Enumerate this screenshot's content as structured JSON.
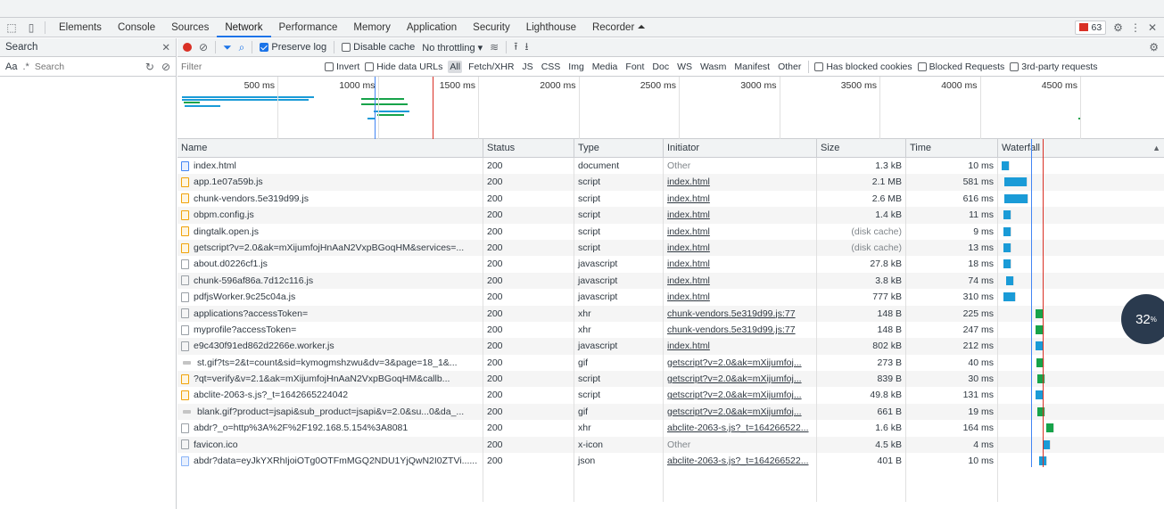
{
  "tabs": [
    "Elements",
    "Console",
    "Sources",
    "Network",
    "Performance",
    "Memory",
    "Application",
    "Security",
    "Lighthouse",
    "Recorder ⏶"
  ],
  "active_tab": "Network",
  "issues_count": "63",
  "left_pane": {
    "title": "Search",
    "aa_label": "Aa",
    "regex_label": ".*",
    "search_placeholder": "Search"
  },
  "toolbar": {
    "preserve_log": "Preserve log",
    "disable_cache": "Disable cache",
    "throttling": "No throttling"
  },
  "filter_bar": {
    "placeholder": "Filter",
    "invert": "Invert",
    "hide_data_urls": "Hide data URLs",
    "types": [
      "All",
      "Fetch/XHR",
      "JS",
      "CSS",
      "Img",
      "Media",
      "Font",
      "Doc",
      "WS",
      "Wasm",
      "Manifest",
      "Other"
    ],
    "has_blocked_cookies": "Has blocked cookies",
    "blocked_requests": "Blocked Requests",
    "third_party": "3rd-party requests"
  },
  "overview_ticks": [
    "500 ms",
    "1000 ms",
    "1500 ms",
    "2000 ms",
    "2500 ms",
    "3000 ms",
    "3500 ms",
    "4000 ms",
    "4500 ms"
  ],
  "columns": [
    "Name",
    "Status",
    "Type",
    "Initiator",
    "Size",
    "Time",
    "Waterfall"
  ],
  "colors": {
    "accent": "#1a73e8",
    "script_bar": "#1a9bd7",
    "xhr_bar": "#17a34a",
    "load_line": "#d93025",
    "dom_line": "#4285f4"
  },
  "rows": [
    {
      "name": "index.html",
      "icon": "doc",
      "status": "200",
      "type": "document",
      "initiator": "Other",
      "init_link": false,
      "size": "1.3 kB",
      "size_muted": false,
      "time": "10 ms"
    },
    {
      "name": "app.1e07a59b.js",
      "icon": "script",
      "status": "200",
      "type": "script",
      "initiator": "index.html",
      "init_link": true,
      "size": "2.1 MB",
      "size_muted": false,
      "time": "581 ms"
    },
    {
      "name": "chunk-vendors.5e319d99.js",
      "icon": "script",
      "status": "200",
      "type": "script",
      "initiator": "index.html",
      "init_link": true,
      "size": "2.6 MB",
      "size_muted": false,
      "time": "616 ms"
    },
    {
      "name": "obpm.config.js",
      "icon": "script",
      "status": "200",
      "type": "script",
      "initiator": "index.html",
      "init_link": true,
      "size": "1.4 kB",
      "size_muted": false,
      "time": "11 ms"
    },
    {
      "name": "dingtalk.open.js",
      "icon": "script",
      "status": "200",
      "type": "script",
      "initiator": "index.html",
      "init_link": true,
      "size": "(disk cache)",
      "size_muted": true,
      "time": "9 ms"
    },
    {
      "name": "getscript?v=2.0&ak=mXijumfojHnAaN2VxpBGoqHM&services=...",
      "icon": "script",
      "status": "200",
      "type": "script",
      "initiator": "index.html",
      "init_link": true,
      "size": "(disk cache)",
      "size_muted": true,
      "time": "13 ms"
    },
    {
      "name": "about.d0226cf1.js",
      "icon": "blank",
      "status": "200",
      "type": "javascript",
      "initiator": "index.html",
      "init_link": true,
      "size": "27.8 kB",
      "size_muted": false,
      "time": "18 ms"
    },
    {
      "name": "chunk-596af86a.7d12c116.js",
      "icon": "blank",
      "status": "200",
      "type": "javascript",
      "initiator": "index.html",
      "init_link": true,
      "size": "3.8 kB",
      "size_muted": false,
      "time": "74 ms"
    },
    {
      "name": "pdfjsWorker.9c25c04a.js",
      "icon": "blank",
      "status": "200",
      "type": "javascript",
      "initiator": "index.html",
      "init_link": true,
      "size": "777 kB",
      "size_muted": false,
      "time": "310 ms"
    },
    {
      "name": "applications?accessToken=",
      "icon": "blank",
      "status": "200",
      "type": "xhr",
      "initiator": "chunk-vendors.5e319d99.js:77",
      "init_link": true,
      "size": "148 B",
      "size_muted": false,
      "time": "225 ms"
    },
    {
      "name": "myprofile?accessToken=",
      "icon": "blank",
      "status": "200",
      "type": "xhr",
      "initiator": "chunk-vendors.5e319d99.js:77",
      "init_link": true,
      "size": "148 B",
      "size_muted": false,
      "time": "247 ms"
    },
    {
      "name": "e9c430f91ed862d2266e.worker.js",
      "icon": "blank",
      "status": "200",
      "type": "javascript",
      "initiator": "index.html",
      "init_link": true,
      "size": "802 kB",
      "size_muted": false,
      "time": "212 ms"
    },
    {
      "name": "st.gif?ts=2&t=count&sid=kymogmshzwu&dv=3&page=18_1&...",
      "icon": "img",
      "status": "200",
      "type": "gif",
      "initiator": "getscript?v=2.0&ak=mXijumfoj...",
      "init_link": true,
      "size": "273 B",
      "size_muted": false,
      "time": "40 ms"
    },
    {
      "name": "?qt=verify&v=2.1&ak=mXijumfojHnAaN2VxpBGoqHM&callb...",
      "icon": "script",
      "status": "200",
      "type": "script",
      "initiator": "getscript?v=2.0&ak=mXijumfoj...",
      "init_link": true,
      "size": "839 B",
      "size_muted": false,
      "time": "30 ms"
    },
    {
      "name": "abclite-2063-s.js?_t=1642665224042",
      "icon": "script",
      "status": "200",
      "type": "script",
      "initiator": "getscript?v=2.0&ak=mXijumfoj...",
      "init_link": true,
      "size": "49.8 kB",
      "size_muted": false,
      "time": "131 ms"
    },
    {
      "name": "blank.gif?product=jsapi&sub_product=jsapi&v=2.0&su...0&da_...",
      "icon": "img",
      "status": "200",
      "type": "gif",
      "initiator": "getscript?v=2.0&ak=mXijumfoj...",
      "init_link": true,
      "size": "661 B",
      "size_muted": false,
      "time": "19 ms"
    },
    {
      "name": "abdr?_o=http%3A%2F%2F192.168.5.154%3A8081",
      "icon": "blank",
      "status": "200",
      "type": "xhr",
      "initiator": "abclite-2063-s.js?_t=164266522...",
      "init_link": true,
      "size": "1.6 kB",
      "size_muted": false,
      "time": "164 ms"
    },
    {
      "name": "favicon.ico",
      "icon": "blank",
      "status": "200",
      "type": "x-icon",
      "initiator": "Other",
      "init_link": false,
      "size": "4.5 kB",
      "size_muted": false,
      "time": "4 ms"
    },
    {
      "name": "abdr?data=eyJkYXRhIjoiOTg0OTFmMGQ2NDU1YjQwN2I0ZTVi......",
      "icon": "json",
      "status": "200",
      "type": "json",
      "initiator": "abclite-2063-s.js?_t=164266522...",
      "init_link": true,
      "size": "401 B",
      "size_muted": false,
      "time": "10 ms"
    }
  ],
  "progress_badge": {
    "value": "32",
    "unit": "%"
  }
}
